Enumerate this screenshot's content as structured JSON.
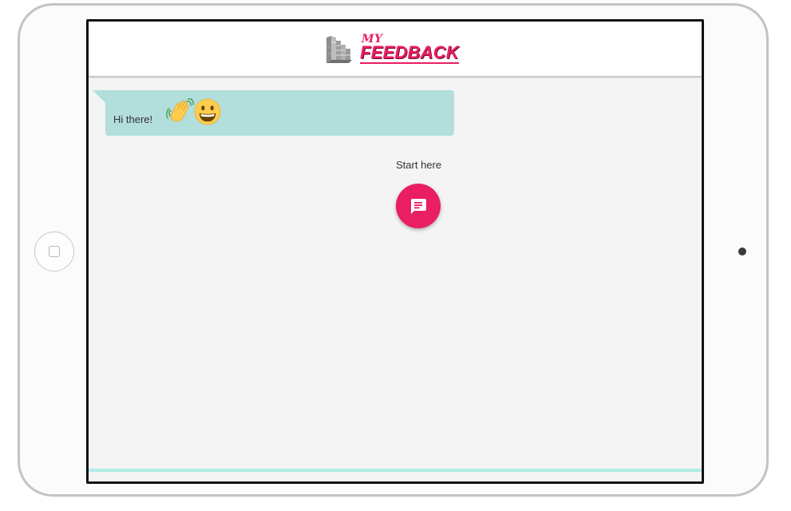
{
  "app": {
    "logo_my": "MY",
    "logo_feedback": "FEEDBACK",
    "brand_color": "#e91e63",
    "accent_color": "#b2dfdb"
  },
  "chat": {
    "greeting_text": "Hi there!",
    "greeting_emojis": [
      "waving-hand",
      "grinning-face"
    ]
  },
  "start": {
    "label": "Start here",
    "icon": "chat-message-icon"
  }
}
